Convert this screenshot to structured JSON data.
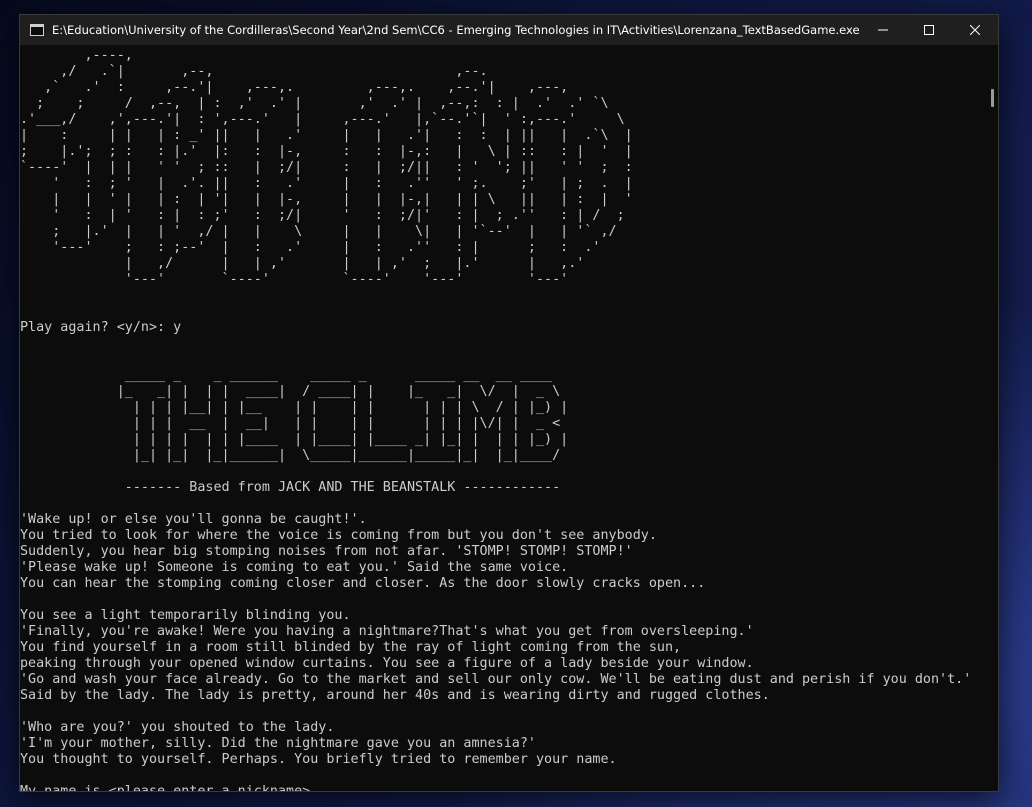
{
  "window": {
    "title": "E:\\Education\\University of the Cordilleras\\Second Year\\2nd Sem\\CC6 - Emerging Technologies in IT\\Activities\\Lorenzana_TextBasedGame.exe",
    "icon": "console-app-icon",
    "controls": {
      "minimize": "minimize-icon",
      "maximize": "maximize-icon",
      "close": "close-icon"
    }
  },
  "console": {
    "banner_end": [
      "        ,----,",
      "     ,/   .`|       ,--,                              ,--.",
      "   ,`   .'  :     ,--.'|    ,---,.         ,---,.    ,--.'|    ,---,",
      "  ;    ;     /  ,--,  | :  ,'  .' |       ,'  .' |  ,--,:  : |  .'  .' `\\",
      ".'___,/    ,',---.'|  : ',---.'   |     ,---.'   |,`--.'`|  ' :,---.'     \\",
      "|    :     | |   | : _' ||   |   .'     |   |   .'|   :  :  | ||   |  .`\\  |",
      ";    |.';  ; :   : |.'  |:   :  |-,     :   :  |-,:   |   \\ | ::   : |  '  |",
      "`----'  |  | |   ' '  ; ::   |  ;/|     :   |  ;/||   : '  '; ||   ' '  ;  :",
      "    '   :  ; '   |  .'. ||   :   .'     |   :   .''   ' ;.    ;'   | ;  .  |",
      "    |   |  ' |   | :  | '|   |  |-,     |   |  |-,|   | | \\   ||   | :  |  '",
      "    '   :  | '   : |  : ;'   :  ;/|     '   :  ;/|'   : |  ; .''   : | /  ;",
      "    ;   |.'  |   | '  ,/ |   |    \\     |   |    \\|   | '`--'  |   | '` ,/",
      "    '---'    ;   : ;--'  |   :   .'     |   :   .''   : |      ;   :  .'",
      "             |   ,/      |   | ,'       |   | ,'  ;   |.'      |   ,.'",
      "             '---'       `----'         `----'    '---'        '---'"
    ],
    "prompt_replay": "Play again? <y/n>: y",
    "banner_title": [
      "             _____ _    _ ______    _____ _      _____ __  __ ____",
      "            |_   _| |  | |  ____|  / ____| |    |_   _|  \\/  |  _ \\",
      "              | | | |__| | |__    | |    | |      | | | \\  / | |_) |",
      "              | | |  __  |  __|   | |    | |      | | | |\\/| |  _ <",
      "              | | | |  | | |____  | |____| |____ _| |_| |  | | |_) |",
      "              |_| |_|  |_|______|  \\_____|______|_____|_|  |_|____/"
    ],
    "subtitle": "             ------- Based from JACK AND THE BEANSTALK ------------",
    "story": [
      "'Wake up! or else you'll gonna be caught!'.",
      "You tried to look for where the voice is coming from but you don't see anybody.",
      "Suddenly, you hear big stomping noises from not afar. 'STOMP! STOMP! STOMP!'",
      "'Please wake up! Someone is coming to eat you.' Said the same voice.",
      "You can hear the stomping coming closer and closer. As the door slowly cracks open...",
      "",
      "You see a light temporarily blinding you.",
      "'Finally, you're awake! Were you having a nightmare?That's what you get from oversleeping.'",
      "You find yourself in a room still blinded by the ray of light coming from the sun,",
      "peaking through your opened window curtains. You see a figure of a lady beside your window.",
      "'Go and wash your face already. Go to the market and sell our only cow. We'll be eating dust and perish if you don't.'",
      "Said by the lady. The lady is pretty, around her 40s and is wearing dirty and rugged clothes.",
      "",
      "'Who are you?' you shouted to the lady.",
      "'I'm your mother, silly. Did the nightmare gave you an amnesia?'",
      "You thought to yourself. Perhaps. You briefly tried to remember your name.",
      ""
    ],
    "input_prompt": "My name is <please enter a nickname>..."
  }
}
